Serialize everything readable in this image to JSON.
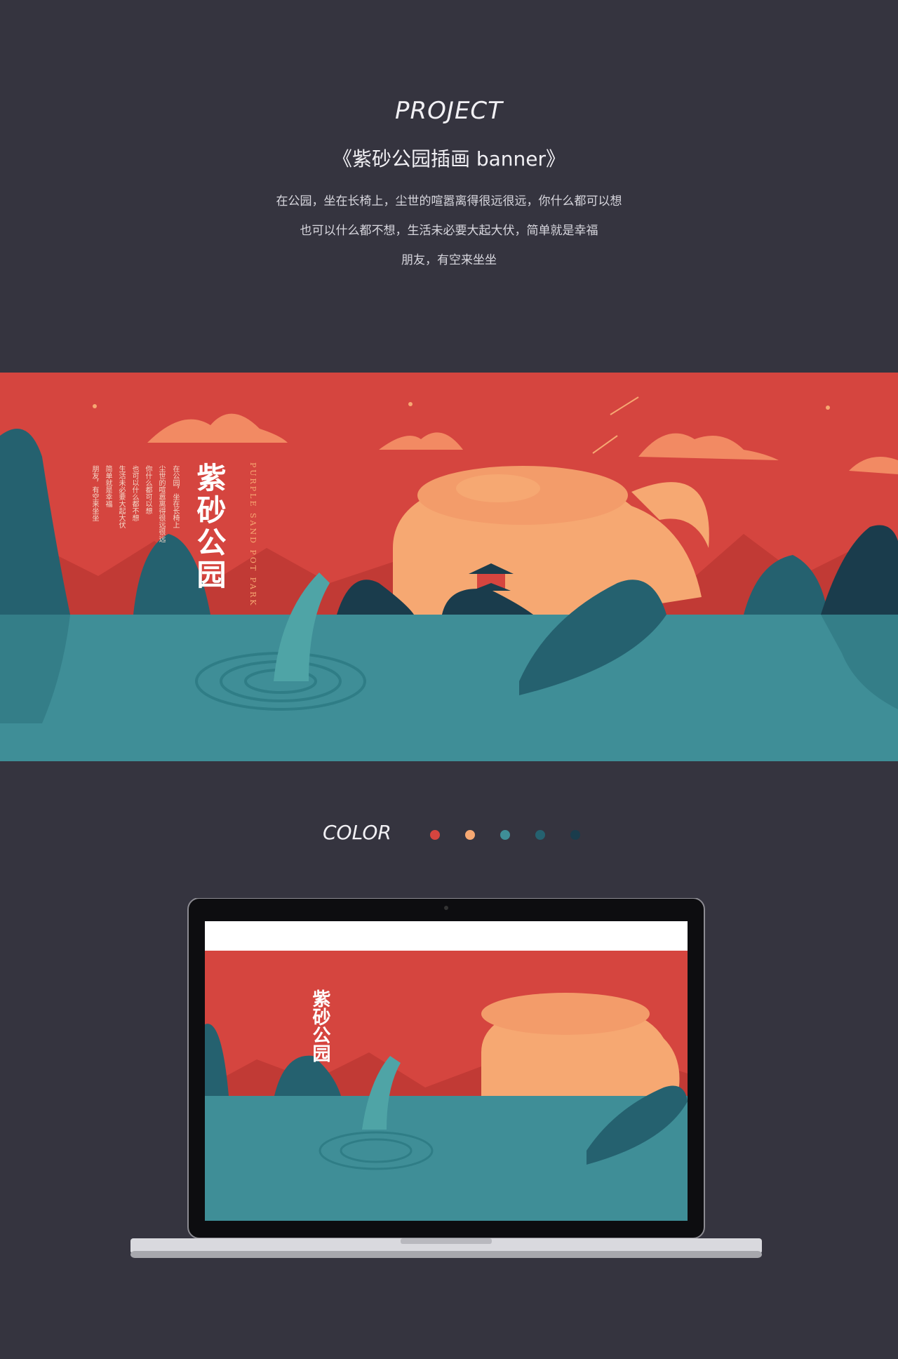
{
  "header": {
    "eyebrow": "PROJECT",
    "title": "《紫砂公园插画 banner》",
    "lines": [
      "在公园，坐在长椅上，尘世的喧嚣离得很远很远，你什么都可以想",
      "也可以什么都不想，生活未必要大起大伏，简单就是幸福",
      "朋友，有空来坐坐"
    ]
  },
  "banner": {
    "title": "紫砂公园",
    "english": "PURPLE SAND POT PARK",
    "poem": [
      "在公园，坐在长椅上",
      "尘世的喧嚣离得很远很远",
      "你什么都可以想",
      "也可以什么都不想",
      "生活未必要大起大伏",
      "简单就是幸福",
      "朋友，有空来坐坐"
    ]
  },
  "palette": {
    "label": "COLOR",
    "colors": [
      "#d5453f",
      "#f6a872",
      "#3f8e97",
      "#25616f",
      "#1a3c4c"
    ]
  }
}
